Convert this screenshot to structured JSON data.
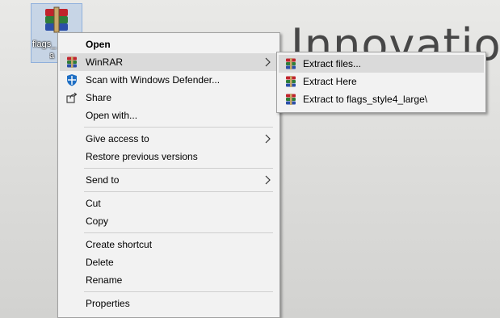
{
  "desktop": {
    "background_text": "Innovatio",
    "icon_label_line1": "flags_",
    "icon_label_line2": "a"
  },
  "context_menu": {
    "items": [
      {
        "label": "Open",
        "bold": true
      },
      {
        "label": "WinRAR",
        "icon": "winrar-icon",
        "submenu": true,
        "highlighted": true
      },
      {
        "label": "Scan with Windows Defender...",
        "icon": "windows-defender-icon"
      },
      {
        "label": "Share",
        "icon": "share-icon"
      },
      {
        "label": "Open with..."
      },
      {
        "label": "Give access to",
        "submenu": true
      },
      {
        "label": "Restore previous versions"
      },
      {
        "label": "Send to",
        "submenu": true
      },
      {
        "label": "Cut"
      },
      {
        "label": "Copy"
      },
      {
        "label": "Create shortcut"
      },
      {
        "label": "Delete"
      },
      {
        "label": "Rename"
      },
      {
        "label": "Properties"
      }
    ]
  },
  "winrar_submenu": {
    "items": [
      {
        "label": "Extract files...",
        "icon": "winrar-extract-icon",
        "highlighted": true
      },
      {
        "label": "Extract Here",
        "icon": "winrar-extract-icon"
      },
      {
        "label": "Extract to flags_style4_large\\",
        "icon": "winrar-extract-icon"
      }
    ]
  },
  "colors": {
    "menu_bg": "#f2f2f2",
    "highlight": "#dadada",
    "separator": "#cfcfcf"
  }
}
